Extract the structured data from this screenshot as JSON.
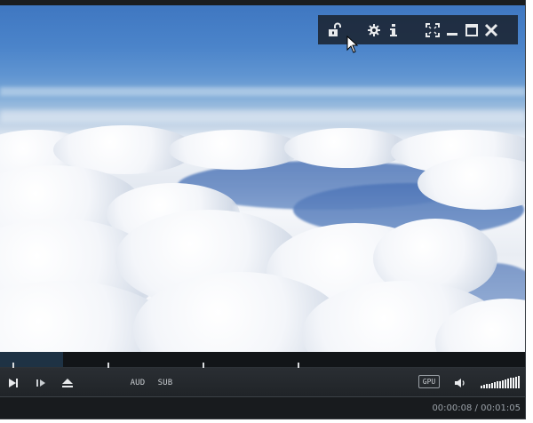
{
  "overlay_toolbar": {
    "icons": [
      "unlock-icon",
      "gear-icon",
      "info-icon",
      "fullscreen-icon",
      "minimize-icon",
      "maximize-icon",
      "close-icon"
    ]
  },
  "seek": {
    "progress": 0.12
  },
  "controls": {
    "aud_label": "AUD",
    "sub_label": "SUB",
    "gpu_label": "GPU",
    "volume_level": 1.0,
    "icons": [
      "play-next-icon",
      "frame-step-icon",
      "eject-icon",
      "speaker-icon"
    ]
  },
  "status": {
    "time_display": "00:00:08 / 00:01:05"
  },
  "colors": {
    "accent": "#1e3244",
    "toolbar_bg": "#1c2634",
    "panel_bg": "#202428",
    "text": "#c9cdd1"
  }
}
